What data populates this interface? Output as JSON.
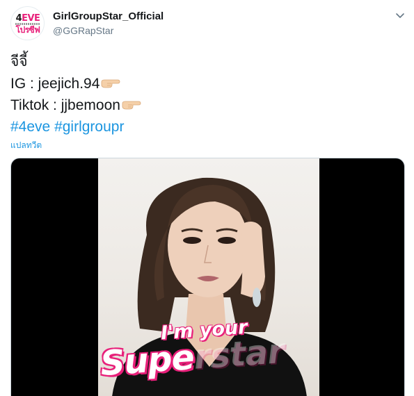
{
  "tweet": {
    "display_name": "GirlGroupStar_Official",
    "handle": "@GGRapStar",
    "avatar": {
      "logo_top_prefix": "4",
      "logo_top_eve": "EVE",
      "logo_bottom": "โปรซีฟ"
    },
    "lines": {
      "name_line": "จีจี้",
      "ig": "IG : jeejich.94",
      "tiktok": "Tiktok : jjbemoon",
      "hashtag1": "#4eve",
      "hashtag2": "#girlgroupr"
    },
    "translate_label": "แปลทวีต",
    "video": {
      "caption_line1": "I'm your",
      "caption_line2_main": "Supe",
      "caption_line2_faded": "rstar"
    }
  },
  "icons": {
    "caret": "chevron-down-icon",
    "pointing": "pointing-right-emoji"
  },
  "colors": {
    "link": "#1b95e0",
    "text": "#14171a",
    "secondary": "#657786",
    "brand_pink": "#e8207a"
  }
}
